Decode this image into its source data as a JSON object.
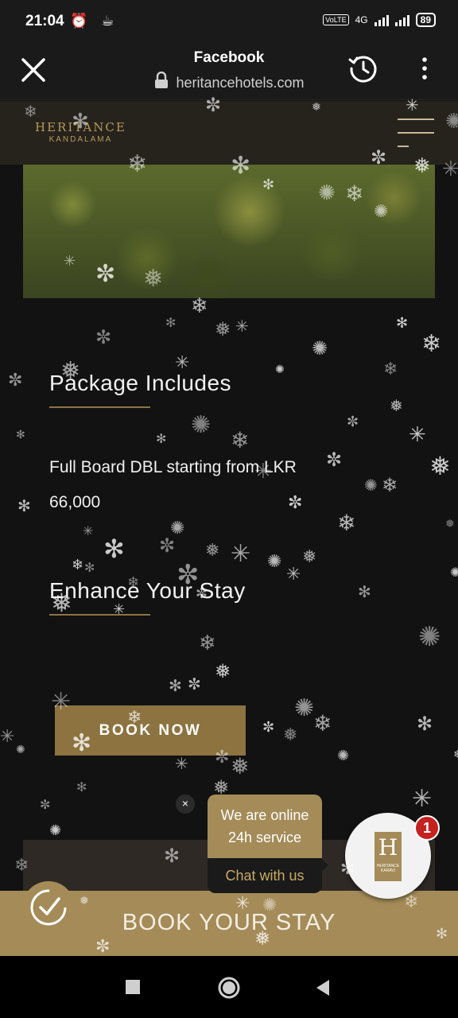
{
  "status_bar": {
    "time": "21:04",
    "battery": "89",
    "network": "4G",
    "volte": "VoLTE"
  },
  "browser": {
    "title": "Facebook",
    "url": "heritancehotels.com"
  },
  "site": {
    "logo_line1": "HERITANCE",
    "logo_line2": "KANDALAMA",
    "package_heading": "Package Includes",
    "package_line1": "Full Board DBL starting from LKR",
    "package_line2": "66,000",
    "enhance_heading": "Enhance Your Stay",
    "book_now": "BOOK NOW",
    "book_your_stay": "BOOK YOUR STAY"
  },
  "chat": {
    "close": "×",
    "line1": "We are online",
    "line2": "24h service",
    "cta": "Chat with us",
    "badge": "1",
    "logo_letter": "H",
    "logo_text": "HERITANCE KARAVI"
  },
  "colors": {
    "accent_gold": "#a48b58",
    "button_gold": "#8c7340",
    "badge_red": "#c42121",
    "background": "#121212"
  }
}
